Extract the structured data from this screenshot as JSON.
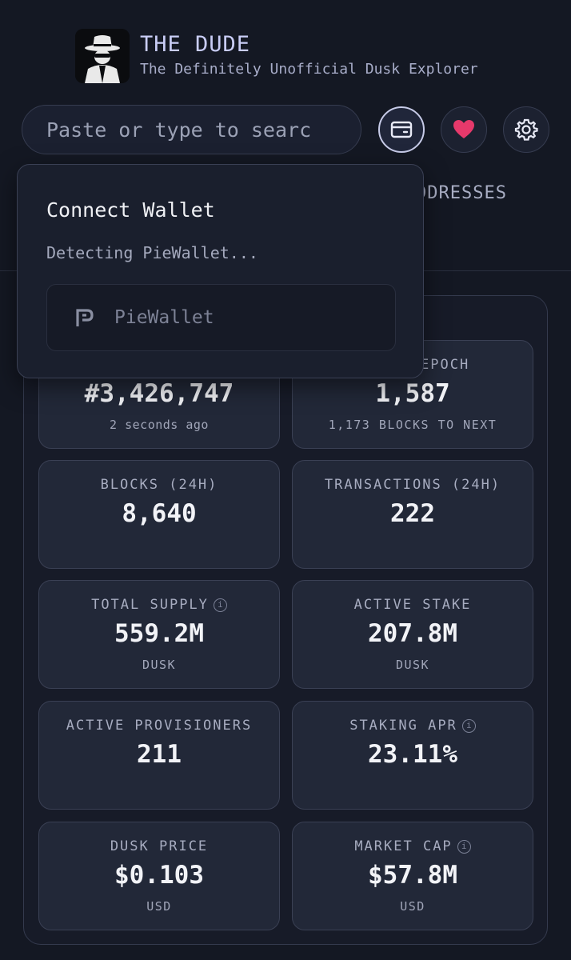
{
  "brand": {
    "title": "THE DUDE",
    "subtitle": "The Definitely Unofficial Dusk Explorer",
    "logo_icon": "detective-hat-icon"
  },
  "search": {
    "placeholder": "Paste or type to searc"
  },
  "toolbar": {
    "wallet_icon": "wallet-icon",
    "favorites_icon": "heart-icon",
    "settings_icon": "gear-icon",
    "heart_color": "#e6396b"
  },
  "tabs": {
    "addresses_partial": "DDRESSES"
  },
  "wallet_popover": {
    "title": "Connect Wallet",
    "status": "Detecting PieWallet...",
    "option_label": "PieWallet"
  },
  "stats": {
    "block": {
      "value": "#3,426,747",
      "sub": "2 seconds ago"
    },
    "epoch": {
      "label": "EPOCH",
      "value": "1,587",
      "sub": "1,173 BLOCKS TO NEXT"
    },
    "blocks_24h": {
      "label": "BLOCKS (24H)",
      "value": "8,640"
    },
    "transactions_24h": {
      "label": "TRANSACTIONS (24H)",
      "value": "222"
    },
    "total_supply": {
      "label": "TOTAL SUPPLY",
      "value": "559.2M",
      "sub": "DUSK"
    },
    "active_stake": {
      "label": "ACTIVE STAKE",
      "value": "207.8M",
      "sub": "DUSK"
    },
    "active_provisioners": {
      "label": "ACTIVE PROVISIONERS",
      "value": "211"
    },
    "staking_apr": {
      "label": "STAKING APR",
      "value": "23.11%"
    },
    "dusk_price": {
      "label": "DUSK PRICE",
      "value": "$0.103",
      "sub": "USD"
    },
    "market_cap": {
      "label": "MARKET CAP",
      "value": "$57.8M",
      "sub": "USD"
    },
    "info_glyph": "i"
  }
}
